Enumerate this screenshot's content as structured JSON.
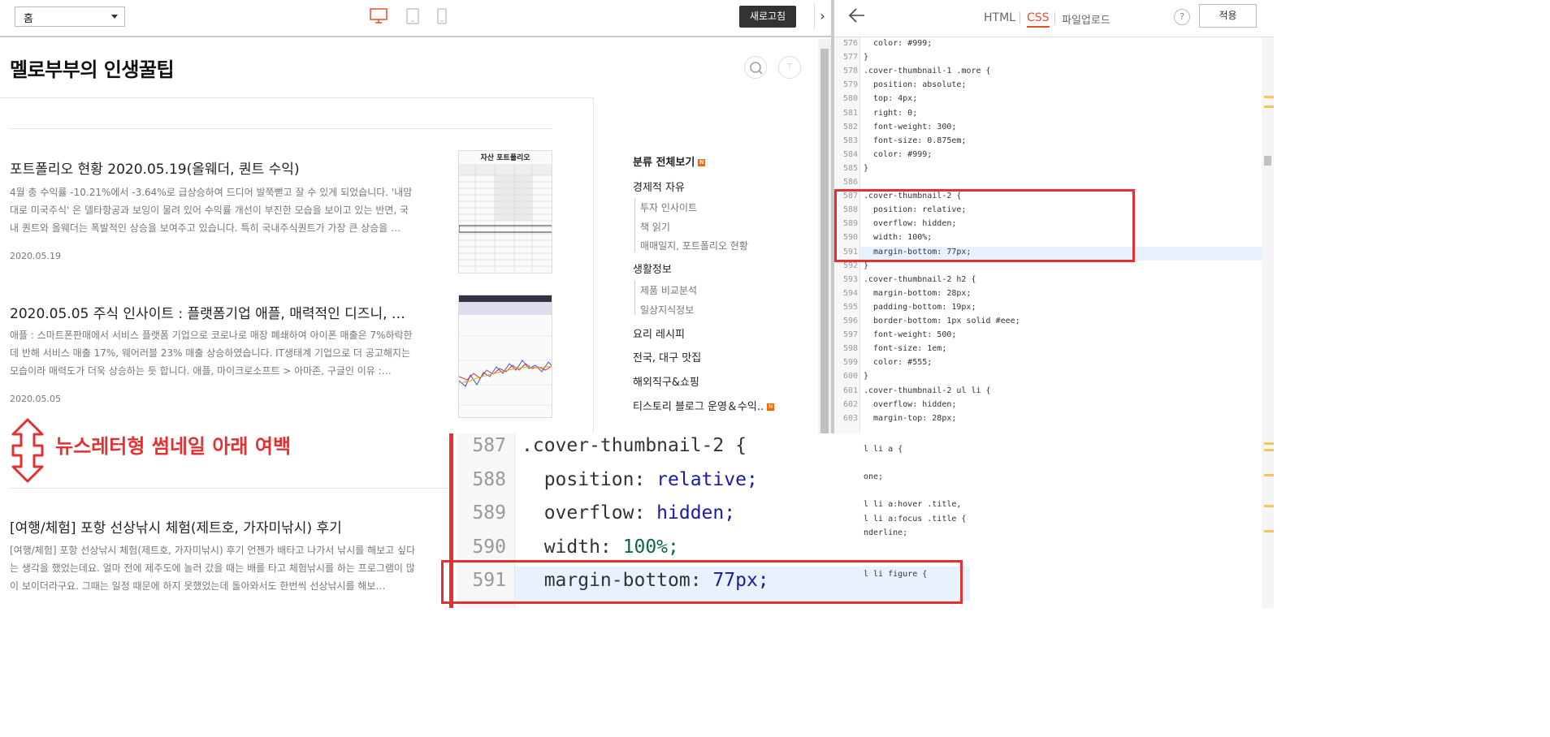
{
  "toolbar": {
    "page_select": "홈",
    "refresh_label": "새로고침",
    "collapse_icon": "chevron-right-icon"
  },
  "blog": {
    "title": "멜로부부의 인생꿀팁",
    "posts": [
      {
        "title": "포트폴리오 현황 2020.05.19(올웨더, 퀀트 수익)",
        "excerpt": "4월 총 수익률 -10.21%에서 -3.64%로 급상승하여 드디어 발쭉뻗고 잘 수 있게 되었습니다. '내맘대로 미국주식' 은 델타항공과 보잉이 물려 있어 수익률 개선이 부진한 모습을 보이고 있는 반면, 국내 퀀트와 올웨더는 폭발적인 상승을 보여주고 있습니다. 특히 국내주식퀀트가 가장 큰 상승을 …",
        "date": "2020.05.19",
        "thumb_title": "자산 포트폴리오"
      },
      {
        "title": "2020.05.05 주식 인사이트 : 플랫폼기업 애플, 매력적인 디즈니, …",
        "excerpt": "애플 : 스마트폰판매에서 서비스 플랫폼 기업으로 코로나로 매장 폐쇄하여 아이폰 매출은 7%하락한 데 반해 서비스 매출 17%, 웨어러블 23% 매출 상승하였습니다. IT생태계 기업으로 더 공고해지는 모습이라 매력도가 더욱 상승하는 듯 합니다. 애플, 마이크로소프트 > 아마존, 구글인 이유 :…",
        "date": "2020.05.05"
      },
      {
        "title": "[여행/체험] 포항 선상낚시 체험(제트호, 가자미낚시) 후기",
        "excerpt": "[여행/체험] 포항 선상낚시 체험(제트호, 가자미낚시) 후기 언젠가 배타고 나가서 낚시를 해보고 싶다는 생각을 했었는데요. 얼마 전에 제주도에 놀러 갔을 때는 배를 타고 체험낚시를 하는 프로그램이 많이 보이더라구요. 그때는 일정 때문에 하지 못했었는데 돌아와서도 한번씩 선상낚시를 해보…"
      }
    ],
    "categories": {
      "all": "분류 전체보기",
      "items": [
        {
          "label": "경제적 자유",
          "subs": [
            "투자 인사이트",
            "책 읽기",
            "매매일지, 포트폴리오 현황"
          ]
        },
        {
          "label": "생활정보",
          "subs": [
            "제품 비교분석",
            "일상지식정보"
          ]
        },
        {
          "label": "요리 레시피",
          "subs": []
        },
        {
          "label": "전국, 대구 맛집",
          "subs": []
        },
        {
          "label": "해외직구&쇼핑",
          "subs": []
        },
        {
          "label": "티스토리 블로그 운영＆수익..",
          "subs": []
        }
      ],
      "new_badge": "N"
    }
  },
  "editor": {
    "tabs": [
      "HTML",
      "CSS",
      "파일업로드"
    ],
    "active_tab": "CSS",
    "help_label": "?",
    "apply_label": "적용",
    "lines": [
      {
        "n": "576",
        "t": "  color: #999;"
      },
      {
        "n": "577",
        "t": "}"
      },
      {
        "n": "578",
        "t": ".cover-thumbnail-1 .more {"
      },
      {
        "n": "579",
        "t": "  position: absolute;"
      },
      {
        "n": "580",
        "t": "  top: 4px;"
      },
      {
        "n": "581",
        "t": "  right: 0;"
      },
      {
        "n": "582",
        "t": "  font-weight: 300;"
      },
      {
        "n": "583",
        "t": "  font-size: 0.875em;"
      },
      {
        "n": "584",
        "t": "  color: #999;"
      },
      {
        "n": "585",
        "t": "}"
      },
      {
        "n": "586",
        "t": ""
      },
      {
        "n": "587",
        "t": ".cover-thumbnail-2 {"
      },
      {
        "n": "588",
        "t": "  position: relative;"
      },
      {
        "n": "589",
        "t": "  overflow: hidden;"
      },
      {
        "n": "590",
        "t": "  width: 100%;"
      },
      {
        "n": "591",
        "t": "  margin-bottom: 77px;"
      },
      {
        "n": "592",
        "t": "}"
      },
      {
        "n": "593",
        "t": ".cover-thumbnail-2 h2 {"
      },
      {
        "n": "594",
        "t": "  margin-bottom: 28px;"
      },
      {
        "n": "595",
        "t": "  padding-bottom: 19px;"
      },
      {
        "n": "596",
        "t": "  border-bottom: 1px solid #eee;"
      },
      {
        "n": "597",
        "t": "  font-weight: 500;"
      },
      {
        "n": "598",
        "t": "  font-size: 1em;"
      },
      {
        "n": "599",
        "t": "  color: #555;"
      },
      {
        "n": "600",
        "t": "}"
      },
      {
        "n": "601",
        "t": ".cover-thumbnail-2 ul li {"
      },
      {
        "n": "602",
        "t": "  overflow: hidden;"
      },
      {
        "n": "603",
        "t": "  margin-top: 28px;"
      }
    ],
    "hidden_tail": [
      "l li a {",
      "",
      "one;",
      "",
      "l li a:hover .title,",
      "l li a:focus .title {",
      "nderline;",
      "",
      "",
      "l li figure {"
    ]
  },
  "annotation": {
    "text": "뉴스레터형 썸네일 아래 여백"
  },
  "zoom": {
    "lines": [
      {
        "n": "587",
        "sel": ".cover-thumbnail-2 {",
        "prop": "",
        "val": ""
      },
      {
        "n": "588",
        "sel": "",
        "prop": "  position: ",
        "val": "relative;"
      },
      {
        "n": "589",
        "sel": "",
        "prop": "  overflow: ",
        "val": "hidden;"
      },
      {
        "n": "590",
        "sel": "",
        "prop": "  width: ",
        "val": "100%;"
      },
      {
        "n": "591",
        "sel": "",
        "prop": "  margin-bottom: ",
        "val": "77px;"
      }
    ]
  },
  "colors": {
    "accent_tab": "#e84c2f",
    "annotation_red": "#e53030",
    "highlight_line": "#e8f2ff"
  }
}
